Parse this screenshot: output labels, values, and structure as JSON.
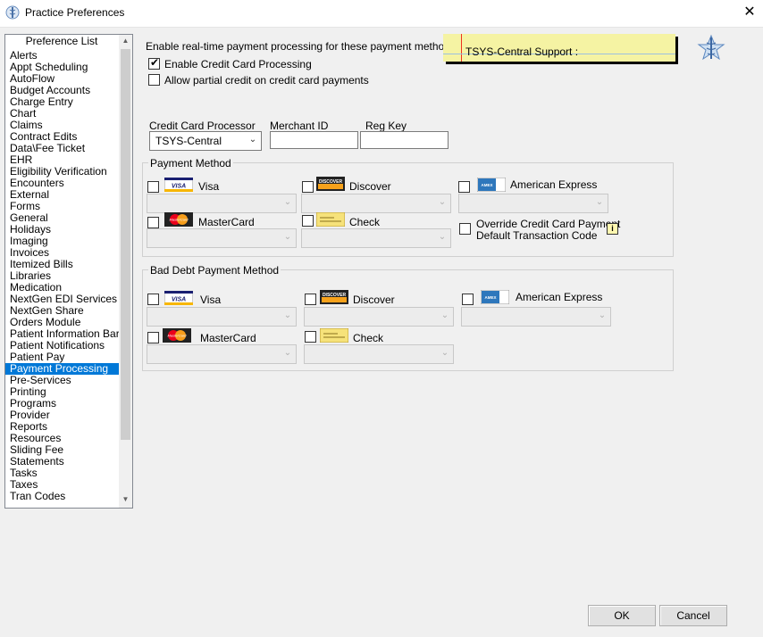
{
  "window": {
    "title": "Practice Preferences",
    "close_symbol": "✕"
  },
  "pref_list": {
    "header": "Preference List",
    "items": [
      "Alerts",
      "Appt Scheduling",
      "AutoFlow",
      "Budget Accounts",
      "Charge Entry",
      "Chart",
      "Claims",
      "Contract Edits",
      "Data\\Fee Ticket",
      "EHR",
      "Eligibility Verification",
      "Encounters",
      "External",
      "Forms",
      "General",
      "Holidays",
      "Imaging",
      "Invoices",
      "Itemized Bills",
      "Libraries",
      "Medication",
      "NextGen EDI Services",
      "NextGen Share",
      "Orders Module",
      "Patient Information Bar",
      "Patient Notifications",
      "Patient Pay",
      "Payment Processing",
      "Pre-Services",
      "Printing",
      "Programs",
      "Provider",
      "Reports",
      "Resources",
      "Sliding Fee",
      "Statements",
      "Tasks",
      "Taxes",
      "Tran Codes"
    ],
    "selected": "Payment Processing"
  },
  "realtime": {
    "heading": "Enable real-time payment processing for these payment methods",
    "enable_cc_label": "Enable Credit Card Processing",
    "enable_cc_checked": true,
    "partial_credit_label": "Allow partial credit on credit card payments",
    "partial_credit_checked": false
  },
  "support_note": {
    "text": "TSYS-Central Support :"
  },
  "processor": {
    "cc_processor_label": "Credit Card Processor",
    "cc_processor_value": "TSYS-Central",
    "merchant_id_label": "Merchant ID",
    "merchant_id_value": "",
    "reg_key_label": "Reg Key",
    "reg_key_value": ""
  },
  "payment_method": {
    "title": "Payment Method",
    "visa": "Visa",
    "discover": "Discover",
    "amex": "American Express",
    "mastercard": "MasterCard",
    "check": "Check",
    "override_line1": "Override Credit Card Payment",
    "override_line2": "Default Transaction Code",
    "info_icon": "i"
  },
  "bad_debt": {
    "title": "Bad Debt Payment Method",
    "visa": "Visa",
    "discover": "Discover",
    "amex": "American Express",
    "mastercard": "MasterCard",
    "check": "Check"
  },
  "logos": {
    "visa": "VISA",
    "discover": "DISCOVER",
    "mastercard": "MasterCard",
    "amex": "AMEX"
  },
  "buttons": {
    "ok": "OK",
    "cancel": "Cancel"
  },
  "symbols": {
    "dropdown_arrow": "⌄",
    "scroll_up": "▲",
    "scroll_down": "▼",
    "checkmark": "✔"
  },
  "colors": {
    "selection": "#0078d7",
    "note_bg": "#f5f3a3"
  }
}
